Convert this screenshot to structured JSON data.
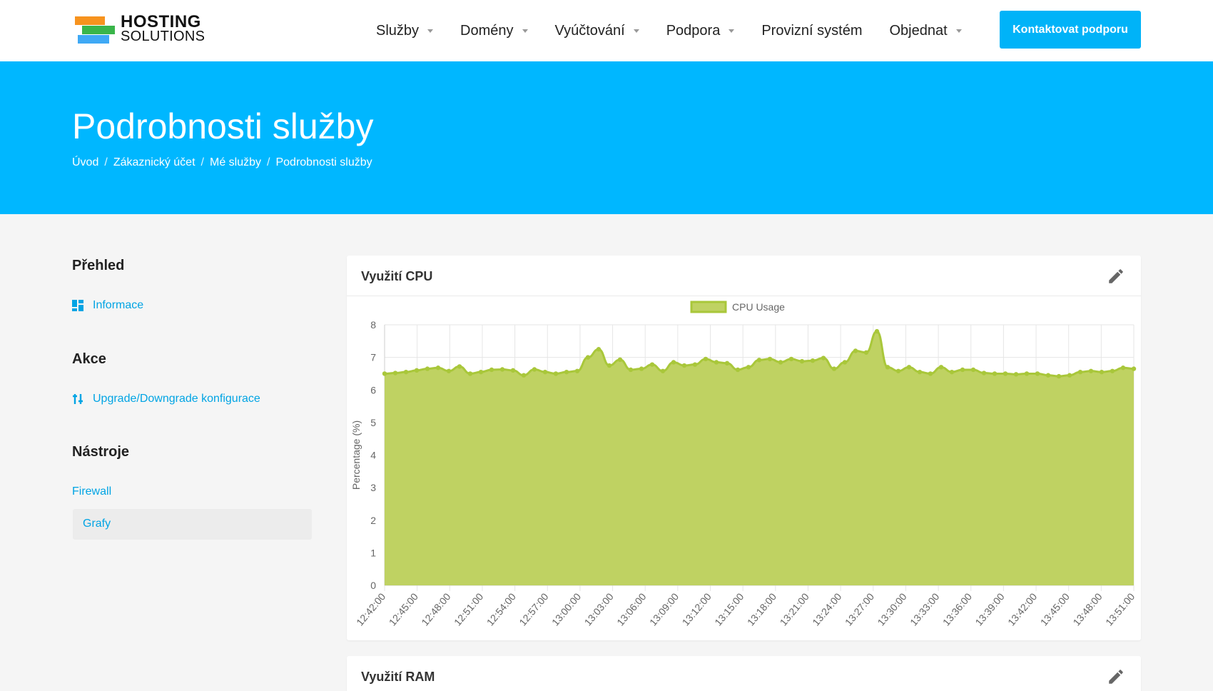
{
  "header": {
    "logo": {
      "line1": "HOSTING",
      "line2": "SOLUTIONS"
    },
    "nav": [
      {
        "label": "Služby",
        "dropdown": true
      },
      {
        "label": "Domény",
        "dropdown": true
      },
      {
        "label": "Vyúčtování",
        "dropdown": true
      },
      {
        "label": "Podpora",
        "dropdown": true
      },
      {
        "label": "Provizní systém",
        "dropdown": false
      },
      {
        "label": "Objednat",
        "dropdown": true
      }
    ],
    "contact_button": "Kontaktovat podporu"
  },
  "hero": {
    "title": "Podrobnosti služby",
    "breadcrumb": [
      "Úvod",
      "Zákaznický účet",
      "Mé služby",
      "Podrobnosti služby"
    ]
  },
  "sidebar": {
    "overview_title": "Přehled",
    "overview_link": "Informace",
    "actions_title": "Akce",
    "actions_link": "Upgrade/Downgrade konfigurace",
    "tools_title": "Nástroje",
    "tools_links": [
      "Firewall",
      "Grafy"
    ]
  },
  "colors": {
    "accent": "#00b7ff",
    "chart_fill": "#bfd262",
    "chart_line": "#a9c73a"
  },
  "cards": {
    "cpu_title": "Využití CPU",
    "ram_title": "Využití RAM"
  },
  "chart_data": {
    "type": "area",
    "legend": "CPU Usage",
    "legend_position": "top",
    "ylabel": "Percentage (%)",
    "ylim": [
      0,
      8
    ],
    "yticks": [
      0,
      1,
      2,
      3,
      4,
      5,
      6,
      7,
      8
    ],
    "grid": true,
    "xtick_labels": [
      "12:42:00",
      "12:45:00",
      "12:48:00",
      "12:51:00",
      "12:54:00",
      "12:57:00",
      "13:00:00",
      "13:03:00",
      "13:06:00",
      "13:09:00",
      "13:12:00",
      "13:15:00",
      "13:18:00",
      "13:21:00",
      "13:24:00",
      "13:27:00",
      "13:30:00",
      "13:33:00",
      "13:36:00",
      "13:39:00",
      "13:42:00",
      "13:45:00",
      "13:48:00",
      "13:51:00"
    ],
    "series": [
      {
        "name": "CPU Usage",
        "values": [
          6.5,
          6.52,
          6.55,
          6.6,
          6.65,
          6.68,
          6.58,
          6.72,
          6.5,
          6.55,
          6.62,
          6.63,
          6.6,
          6.45,
          6.63,
          6.55,
          6.5,
          6.55,
          6.58,
          7.0,
          7.25,
          6.75,
          6.93,
          6.62,
          6.65,
          6.78,
          6.58,
          6.85,
          6.75,
          6.78,
          6.95,
          6.85,
          6.82,
          6.62,
          6.7,
          6.92,
          6.95,
          6.85,
          6.95,
          6.88,
          6.9,
          6.98,
          6.65,
          6.85,
          7.2,
          7.15,
          7.8,
          6.7,
          6.58,
          6.7,
          6.55,
          6.5,
          6.7,
          6.55,
          6.62,
          6.62,
          6.52,
          6.5,
          6.5,
          6.48,
          6.5,
          6.5,
          6.45,
          6.42,
          6.45,
          6.55,
          6.58,
          6.55,
          6.58,
          6.68,
          6.65
        ]
      }
    ]
  }
}
